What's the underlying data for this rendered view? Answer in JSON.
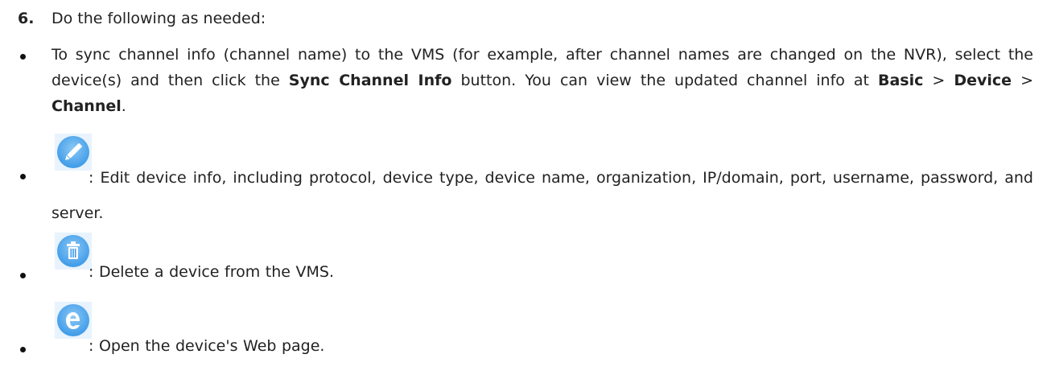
{
  "step": {
    "number": "6.",
    "text": "Do the following as needed:"
  },
  "items": [
    {
      "text_part1": "To sync channel info (channel name) to the VMS (for example, after channel names are changed on the NVR), select the device(s) and then click the ",
      "bold1": "Sync Channel Info",
      "text_part2": " button. You can view the updated channel info at ",
      "bold2": "Basic",
      "sep1": " > ",
      "bold3": "Device",
      "sep2": " > ",
      "bold4": "Channel",
      "end": "."
    },
    {
      "icon": "edit-pencil-icon",
      "text": ": Edit device info, including protocol, device type, device name, organization, IP/domain, port, username, password, and server."
    },
    {
      "icon": "delete-trash-icon",
      "text": ": Delete a device from the VMS."
    },
    {
      "icon": "web-browser-e-icon",
      "text": ": Open the device's Web page."
    }
  ],
  "colors": {
    "icon_blue": "#3d9ae8",
    "icon_light": "#8cc8f5",
    "text": "#222222"
  }
}
